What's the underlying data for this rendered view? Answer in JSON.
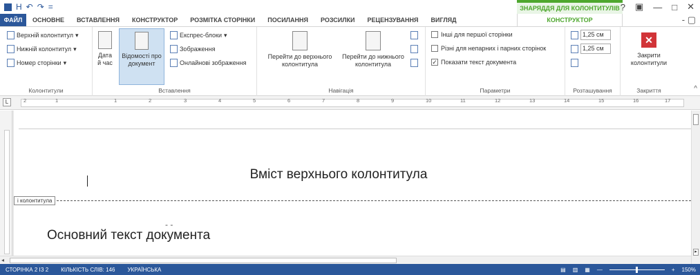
{
  "qat": {
    "save": "H",
    "undo": "↶",
    "redo": "↷",
    "customize": "="
  },
  "context_title": "ЗНАРЯДДЯ ДЛЯ КОЛОНТИТУЛІВ",
  "window": {
    "help": "?",
    "restore_ribbon": "▣",
    "minimize": "—",
    "maximize": "□",
    "close": "✕"
  },
  "tabs": {
    "file": "ФАЙЛ",
    "items": [
      "ОСНОВНЕ",
      "ВСТАВЛЕННЯ",
      "КОНСТРУКТОР",
      "РОЗМІТКА СТОРІНКИ",
      "ПОСИЛАННЯ",
      "РОЗСИЛКИ",
      "РЕЦЕНЗУВАННЯ",
      "ВИГЛЯД"
    ],
    "active": "КОНСТРУКТОР"
  },
  "ribbon": {
    "kolontytuly": {
      "header": "Верхній колонтитул",
      "footer": "Нижній колонтитул",
      "page_number": "Номер сторінки",
      "label": "Колонтитули"
    },
    "vstavlennia": {
      "date_time": [
        "Дата",
        "й час"
      ],
      "doc_info": [
        "Відомості про",
        "документ"
      ],
      "quick_parts": "Експрес-блоки",
      "pictures": "Зображення",
      "online_pictures": "Онлайнові зображення",
      "label": "Вставлення"
    },
    "navigation": {
      "goto_header": [
        "Перейти до верхнього",
        "колонтитула"
      ],
      "goto_footer": [
        "Перейти до нижнього",
        "колонтитула"
      ],
      "label": "Навігація"
    },
    "params": {
      "diff_first": "Інші для першої сторінки",
      "diff_odd_even": "Різні для непарних і парних сторінок",
      "show_text": "Показати текст документа",
      "label": "Параметри",
      "show_checked": "✓"
    },
    "position": {
      "top": "1,25 см",
      "bottom": "1,25 см",
      "label": "Розташування"
    },
    "close": {
      "btn": [
        "Закрити",
        "колонтитули"
      ],
      "label": "Закриття",
      "x": "✕"
    }
  },
  "ruler": {
    "marks": [
      "2",
      "1",
      "1",
      "2",
      "3",
      "4",
      "5",
      "6",
      "7",
      "8",
      "9",
      "10",
      "11",
      "12",
      "13",
      "14",
      "15",
      "16",
      "17"
    ],
    "tabstop": "L"
  },
  "document": {
    "header_text": "Вміст верхнього колонтитула",
    "header_tag": "і колонтитула",
    "dots": "-  -",
    "body_text": "Основний текст документа"
  },
  "status": {
    "page": "СТОРІНКА 2 ІЗ 2",
    "words": "КІЛЬКІСТЬ СЛІВ: 146",
    "lang": "УКРАЇНСЬКА",
    "zoom": "150%",
    "zoom_minus": "—",
    "zoom_plus": "+"
  }
}
